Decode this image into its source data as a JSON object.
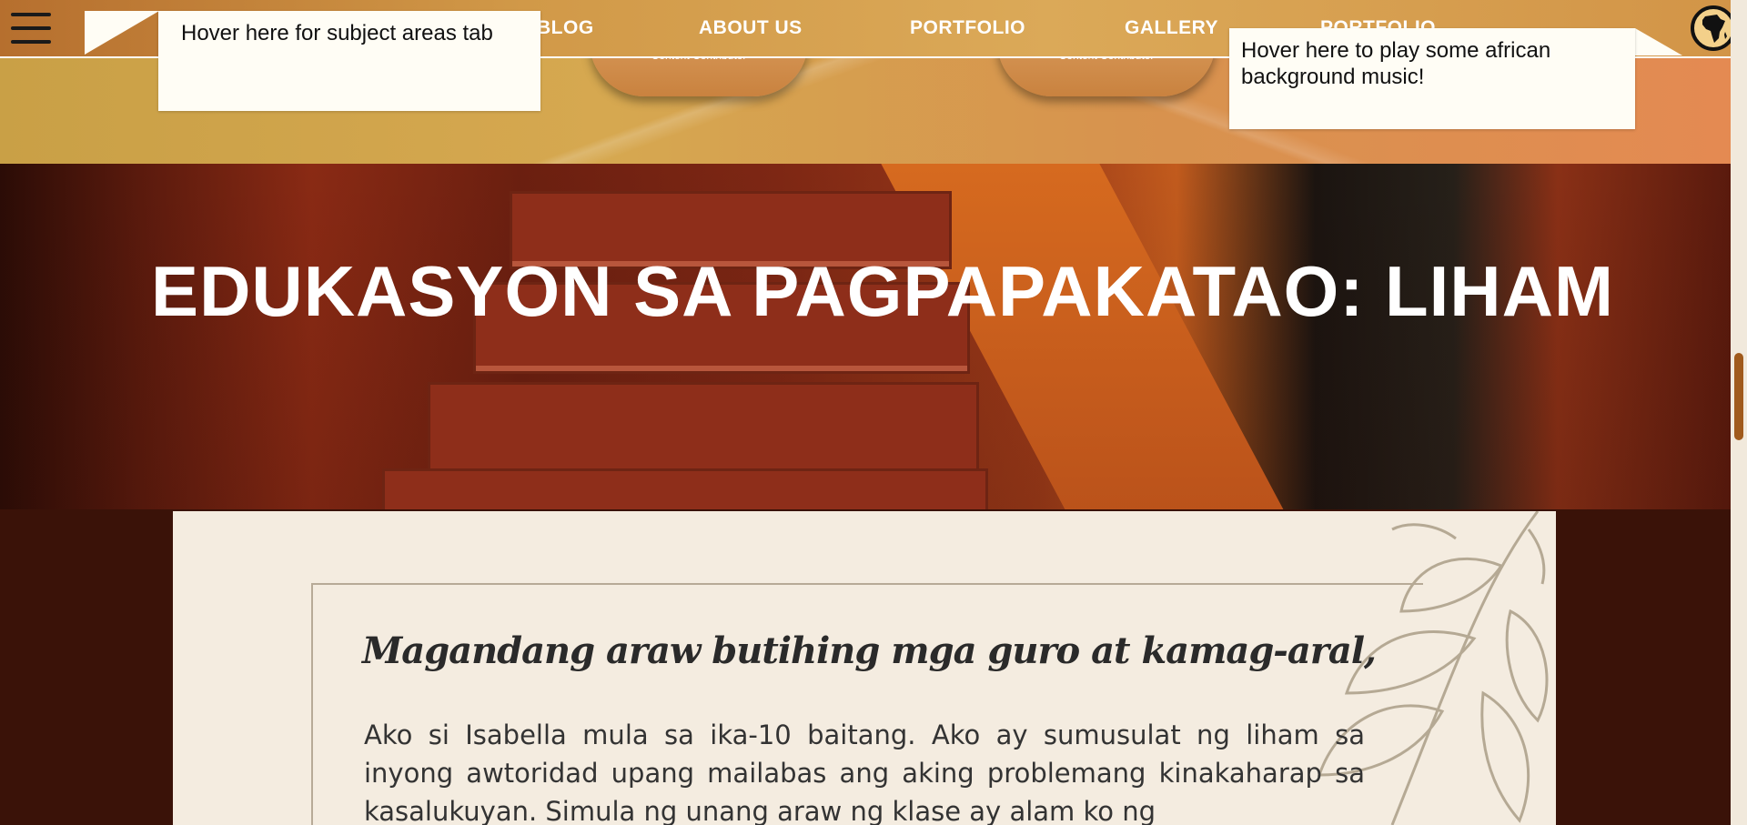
{
  "nav": {
    "links": [
      "BLOG",
      "ABOUT US",
      "PORTFOLIO",
      "GALLERY",
      "PORTFOLIO"
    ]
  },
  "cards": {
    "caption_left": "Content Contributor",
    "caption_right": "Content Contributor"
  },
  "tooltips": {
    "left": "Hover here for subject areas tab",
    "right": "Hover here to play some african background music!"
  },
  "hero": {
    "title": "EDUKASYON SA PAGPAPAKATAO: LIHAM"
  },
  "letter": {
    "greeting": "Magandang araw butihing mga guro at kamag-aral,",
    "body": "Ako si Isabella mula sa ika-10 baitang. Ako ay sumusulat ng liham sa inyong awtoridad upang mailabas ang aking problemang kinakaharap sa kasalukuyan. Simula ng unang araw ng klase ay alam ko ng"
  },
  "colors": {
    "nav_gradient_start": "#b66f2e",
    "scroll_thumb": "#a05a1c",
    "letter_bg": "#f4ece0"
  },
  "icons": [
    "hamburger-menu-icon",
    "africa-map-icon"
  ]
}
